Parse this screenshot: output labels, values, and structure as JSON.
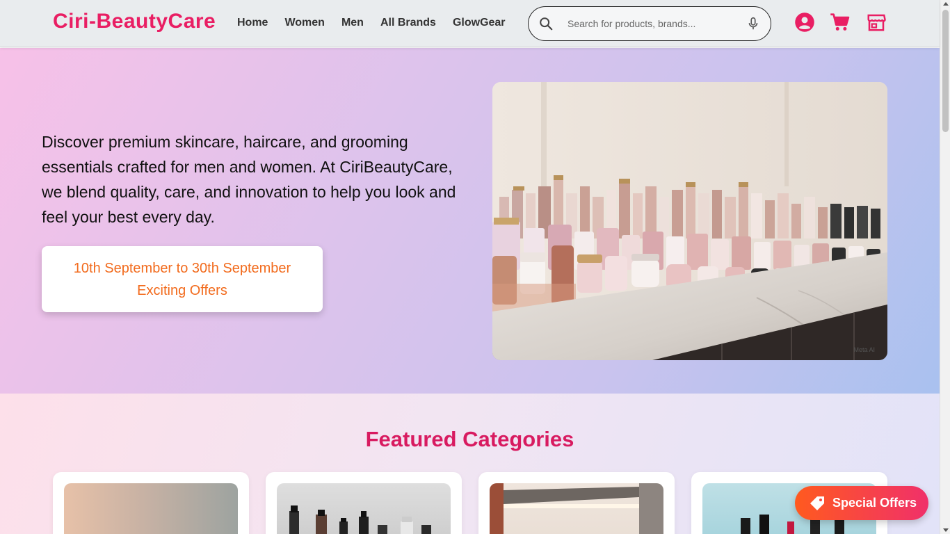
{
  "header": {
    "logo": "Ciri-BeautyCare",
    "nav": [
      "Home",
      "Women",
      "Men",
      "All Brands",
      "GlowGear"
    ],
    "search_placeholder": "Search for products, brands...",
    "accent": "#e91e63"
  },
  "hero": {
    "text": "Discover premium skincare, haircare, and grooming essentials crafted for men and women. At CiriBeautyCare, we blend quality, care, and innovation to help you look and feel your best every day.",
    "offer_line1": "10th September to 30th September",
    "offer_line2": "Exciting Offers",
    "watermark": "Meta AI",
    "offer_color": "#f26b1d"
  },
  "featured": {
    "title": "Featured Categories",
    "title_color": "#d81b60"
  },
  "special_offers": {
    "label": "Special Offers"
  }
}
